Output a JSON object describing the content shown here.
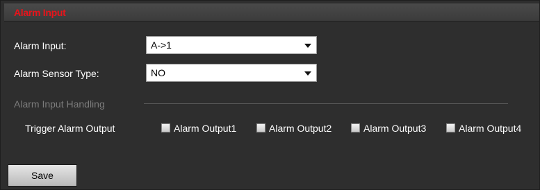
{
  "header": {
    "title": "Alarm Input"
  },
  "form": {
    "alarm_input": {
      "label": "Alarm Input:",
      "value": "A->1"
    },
    "sensor_type": {
      "label": "Alarm Sensor Type:",
      "value": "NO"
    }
  },
  "handling": {
    "section_title": "Alarm Input Handling",
    "trigger_label": "Trigger Alarm Output",
    "outputs": [
      {
        "label": "Alarm Output1",
        "checked": false
      },
      {
        "label": "Alarm Output2",
        "checked": false
      },
      {
        "label": "Alarm Output3",
        "checked": false
      },
      {
        "label": "Alarm Output4",
        "checked": false
      }
    ]
  },
  "actions": {
    "save_label": "Save"
  }
}
